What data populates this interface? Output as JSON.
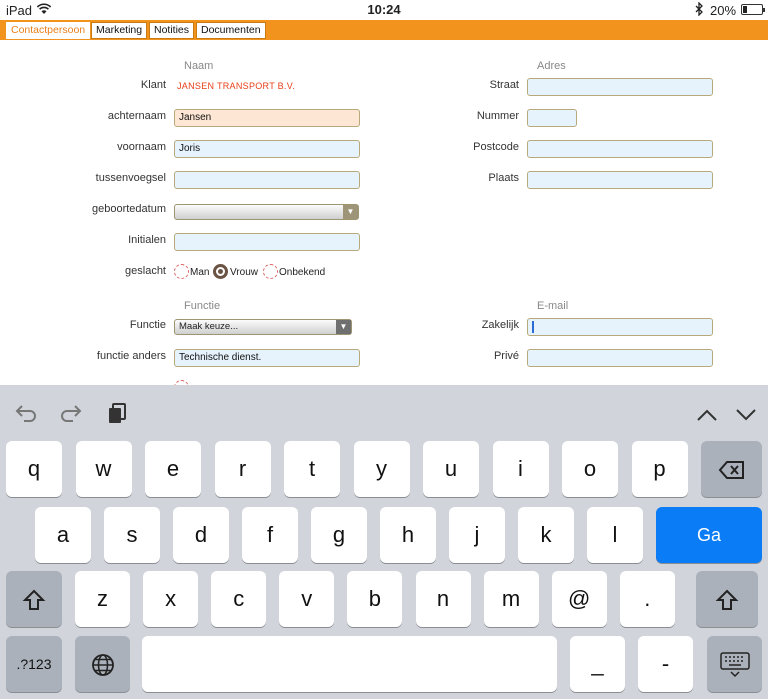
{
  "status_bar": {
    "carrier": "iPad",
    "time": "10:24",
    "battery": "20%",
    "battery_level": 0.2
  },
  "tabs": [
    "Contactpersoon",
    "Marketing",
    "Notities",
    "Documenten"
  ],
  "naam": {
    "heading": "Naam",
    "klant_label": "Klant",
    "klant_value": "JANSEN TRANSPORT B.V.",
    "achternaam_label": "achternaam",
    "achternaam_value": "Jansen",
    "voornaam_label": "voornaam",
    "voornaam_value": "Joris",
    "tussenvoegsel_label": "tussenvoegsel",
    "geboortedatum_label": "geboortedatum",
    "initialen_label": "Initialen",
    "geslacht_label": "geslacht",
    "geslacht_options": [
      "Man",
      "Vrouw",
      "Onbekend"
    ],
    "geslacht_selected": "Vrouw"
  },
  "adres": {
    "heading": "Adres",
    "straat_label": "Straat",
    "nummer_label": "Nummer",
    "postcode_label": "Postcode",
    "plaats_label": "Plaats"
  },
  "functie": {
    "heading": "Functie",
    "functie_label": "Functie",
    "functie_value": "Maak keuze...",
    "functie_anders_label": "functie anders",
    "functie_anders_value": "Technische dienst."
  },
  "email": {
    "heading": "E-mail",
    "zakelijk_label": "Zakelijk",
    "prive_label": "Privé"
  },
  "keyboard": {
    "row1": [
      "q",
      "w",
      "e",
      "r",
      "t",
      "y",
      "u",
      "i",
      "o",
      "p"
    ],
    "row2": [
      "a",
      "s",
      "d",
      "f",
      "g",
      "h",
      "j",
      "k",
      "l"
    ],
    "row3": [
      "z",
      "x",
      "c",
      "v",
      "b",
      "n",
      "m",
      "@",
      "."
    ],
    "go": "Ga",
    "numbers": ".?123",
    "underscore": "_",
    "dash": "-",
    "icons": [
      "undo-icon",
      "redo-icon",
      "paste-icon",
      "chevron-up-icon",
      "chevron-down-icon",
      "backspace-icon",
      "shift-icon",
      "globe-icon",
      "keyboard-dismiss-icon"
    ]
  }
}
